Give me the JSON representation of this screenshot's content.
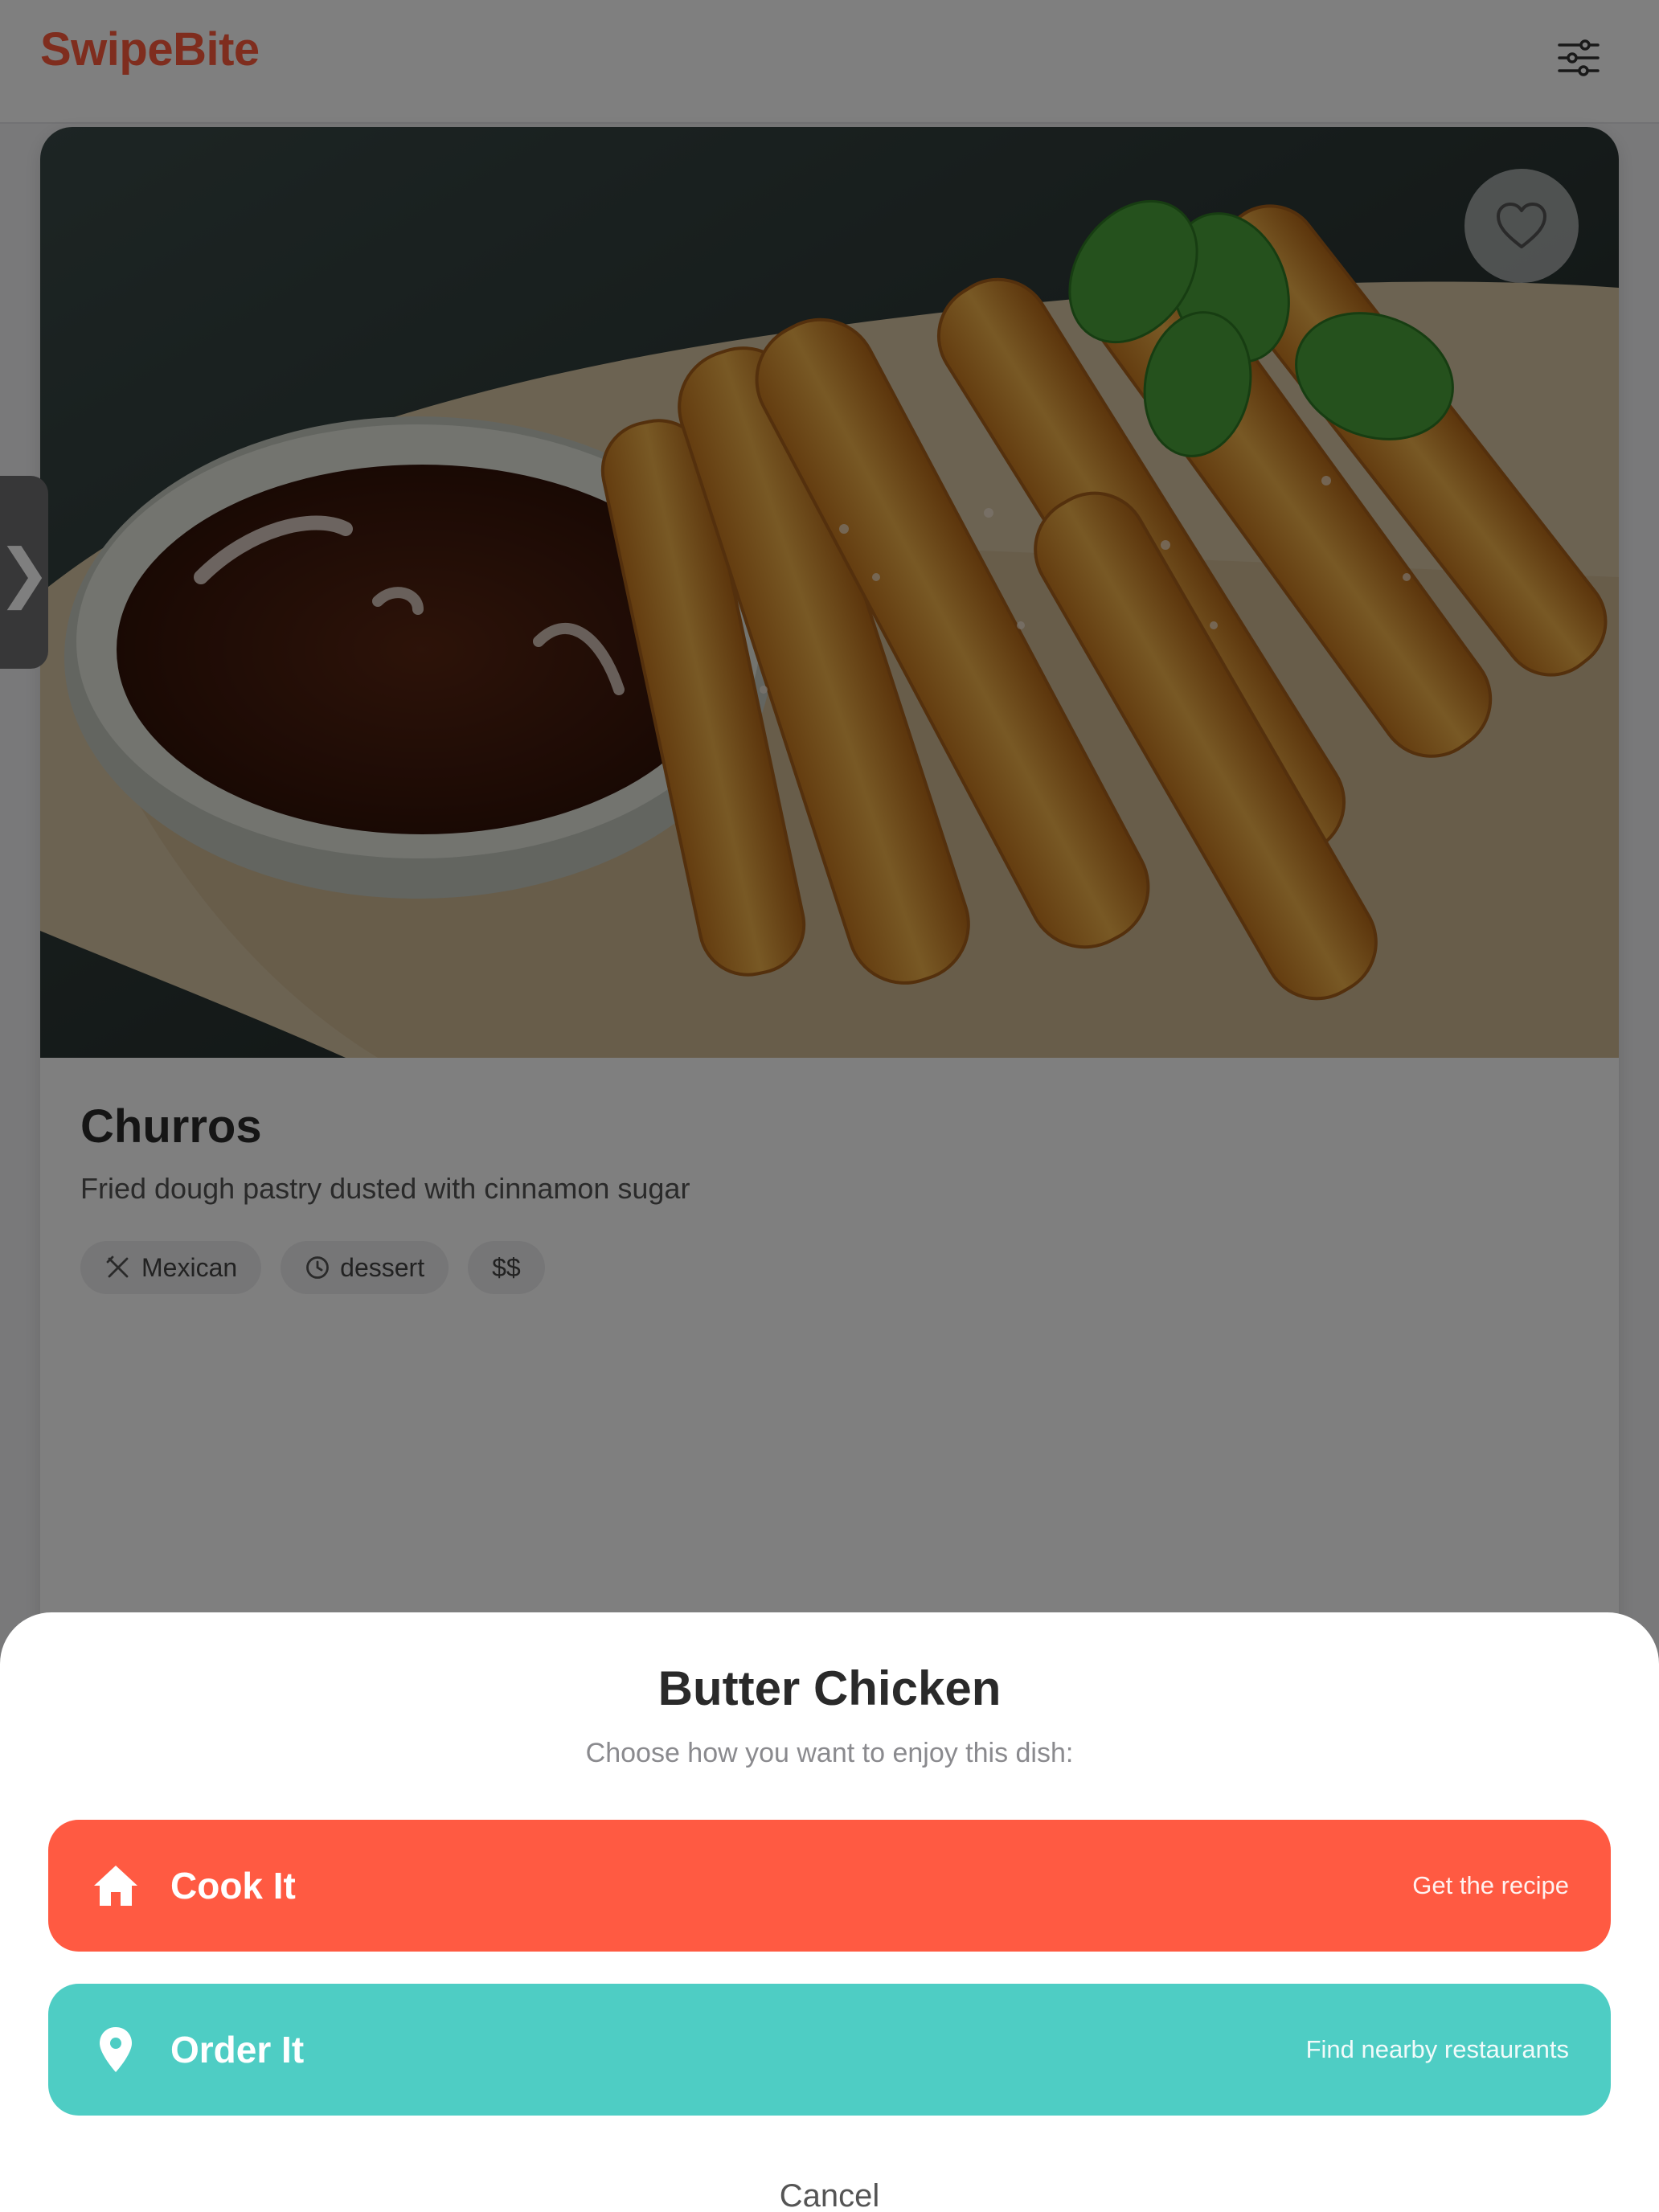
{
  "header": {
    "brand": "SwipeBite",
    "filter_icon": "sliders-icon"
  },
  "card": {
    "title": "Churros",
    "description": "Fried dough pastry dusted with cinnamon sugar",
    "favorite_icon": "heart-icon",
    "tags": [
      {
        "icon": "utensils-icon",
        "label": "Mexican"
      },
      {
        "icon": "clock-icon",
        "label": "dessert"
      },
      {
        "label": "$$"
      }
    ]
  },
  "side_handle": {
    "glyph": "❯",
    "icon": "chevron-right-icon"
  },
  "sheet": {
    "title": "Butter Chicken",
    "subtitle": "Choose how you want to enjoy this dish:",
    "cook": {
      "label": "Cook It",
      "hint": "Get the recipe",
      "icon": "home-icon",
      "color": "#ff5a42"
    },
    "order": {
      "label": "Order It",
      "hint": "Find nearby restaurants",
      "icon": "location-pin-icon",
      "color": "#4ecdc4"
    },
    "cancel": "Cancel"
  },
  "colors": {
    "brand": "#ff5a3c",
    "overlay": "rgba(0,0,0,0.5)"
  }
}
